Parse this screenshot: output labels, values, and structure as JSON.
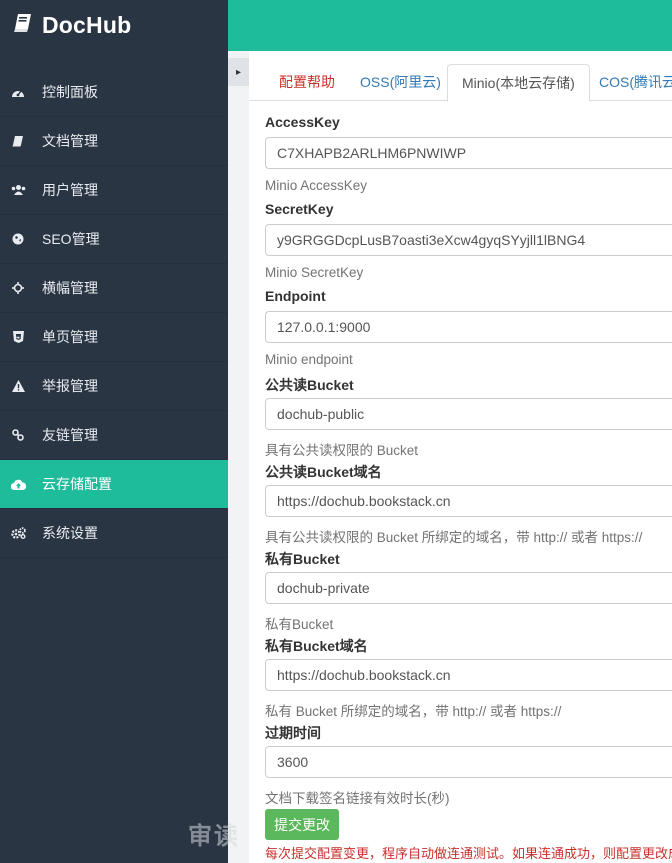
{
  "brand": {
    "name": "DocHub",
    "icon": "book-icon"
  },
  "sidebar": {
    "items": [
      {
        "label": "控制面板",
        "icon": "dashboard-icon"
      },
      {
        "label": "文档管理",
        "icon": "book-icon"
      },
      {
        "label": "用户管理",
        "icon": "users-icon"
      },
      {
        "label": "SEO管理",
        "icon": "globe-icon"
      },
      {
        "label": "横幅管理",
        "icon": "crosshair-icon"
      },
      {
        "label": "单页管理",
        "icon": "html5-icon"
      },
      {
        "label": "举报管理",
        "icon": "warning-icon"
      },
      {
        "label": "友链管理",
        "icon": "link-icon"
      },
      {
        "label": "云存储配置",
        "icon": "cloud-upload-icon",
        "active": true
      },
      {
        "label": "系统设置",
        "icon": "cogs-icon"
      }
    ]
  },
  "toggle": {
    "glyph": "▸"
  },
  "tabs": {
    "help": "配置帮助",
    "oss": "OSS(阿里云)",
    "minio": "Minio(本地云存储)",
    "cos": "COS(腾讯云)"
  },
  "fields": [
    {
      "label": "AccessKey",
      "value": "C7XHAPB2ARLHM6PNWIWP",
      "hint": "Minio AccessKey"
    },
    {
      "label": "SecretKey",
      "value": "y9GRGGDcpLusB7oasti3eXcw4gyqSYyjll1lBNG4",
      "hint": "Minio SecretKey"
    },
    {
      "label": "Endpoint",
      "value": "127.0.0.1:9000",
      "hint": "Minio endpoint"
    },
    {
      "label": "公共读Bucket",
      "value": "dochub-public",
      "hint": "具有公共读权限的 Bucket"
    },
    {
      "label": "公共读Bucket域名",
      "value": "https://dochub.bookstack.cn",
      "hint": "具有公共读权限的 Bucket 所绑定的域名，带 http:// 或者 https://"
    },
    {
      "label": "私有Bucket",
      "value": "dochub-private",
      "hint": "私有Bucket"
    },
    {
      "label": "私有Bucket域名",
      "value": "https://dochub.bookstack.cn",
      "hint": "私有 Bucket 所绑定的域名，带 http:// 或者 https://"
    },
    {
      "label": "过期时间",
      "value": "3600",
      "hint": "文档下载签名链接有效时长(秒)"
    }
  ],
  "submit_label": "提交更改",
  "note": "每次提交配置变更，程序自动做连通测试。如果连通成功，则配置更改成功",
  "watermark": "审读",
  "colors": {
    "sidebar": "#2a3543",
    "accent": "#1fbc9c",
    "submit": "#5cb85c",
    "danger": "#c9302c"
  }
}
